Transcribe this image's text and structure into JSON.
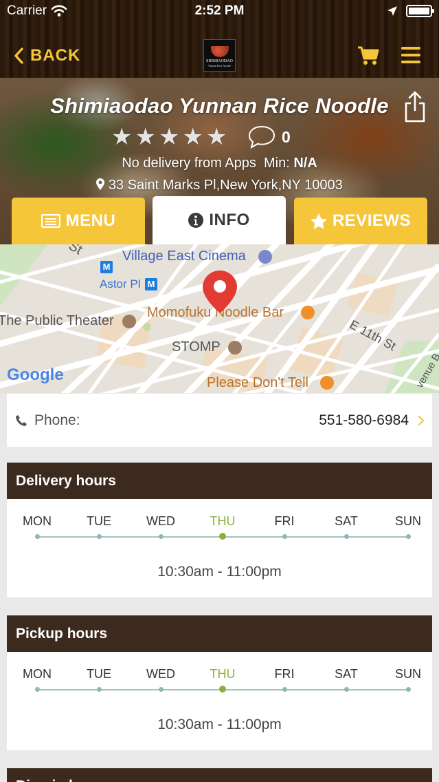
{
  "status_bar": {
    "carrier": "Carrier",
    "time": "2:52 PM"
  },
  "header": {
    "back_label": "BACK",
    "logo_line1": "SHIMIAODAO",
    "logo_line2": "Yunnan Rice Noodle",
    "accent_color": "#f5c53a"
  },
  "restaurant": {
    "name": "Shimiaodao Yunnan Rice Noodle",
    "rating_stars": 0,
    "rating_max": 5,
    "review_count": "0",
    "delivery_text": "No delivery from Apps",
    "min_label": "Min:",
    "min_value": "N/A",
    "address": "33 Saint Marks Pl,New York,NY 10003"
  },
  "tabs": [
    {
      "label": "MENU",
      "icon": "menu-list-icon",
      "active": false
    },
    {
      "label": "INFO",
      "icon": "info-circle-icon",
      "active": true
    },
    {
      "label": "REVIEWS",
      "icon": "star-icon",
      "active": false
    }
  ],
  "map": {
    "labels": {
      "village_east": "Village East Cinema",
      "astor": "Astor Pl",
      "public_theater": "The Public Theater",
      "momofuku": "Momofuku Noodle Bar",
      "stomp": "STOMP",
      "please_dont_tell": "Please Don't Tell",
      "e11th": "E 11th St",
      "st_top": "St",
      "avenue": "venue B",
      "google": "Google"
    }
  },
  "contact": {
    "phone_label": "Phone:",
    "phone_value": "551-580-6984"
  },
  "delivery_hours": {
    "title": "Delivery hours",
    "days": [
      "MON",
      "TUE",
      "WED",
      "THU",
      "FRI",
      "SAT",
      "SUN"
    ],
    "today_index": 3,
    "range": "10:30am - 11:00pm"
  },
  "pickup_hours": {
    "title": "Pickup hours",
    "days": [
      "MON",
      "TUE",
      "WED",
      "THU",
      "FRI",
      "SAT",
      "SUN"
    ],
    "today_index": 3,
    "range": "10:30am - 11:00pm"
  },
  "next_section": {
    "title": "Dine-in hours"
  }
}
